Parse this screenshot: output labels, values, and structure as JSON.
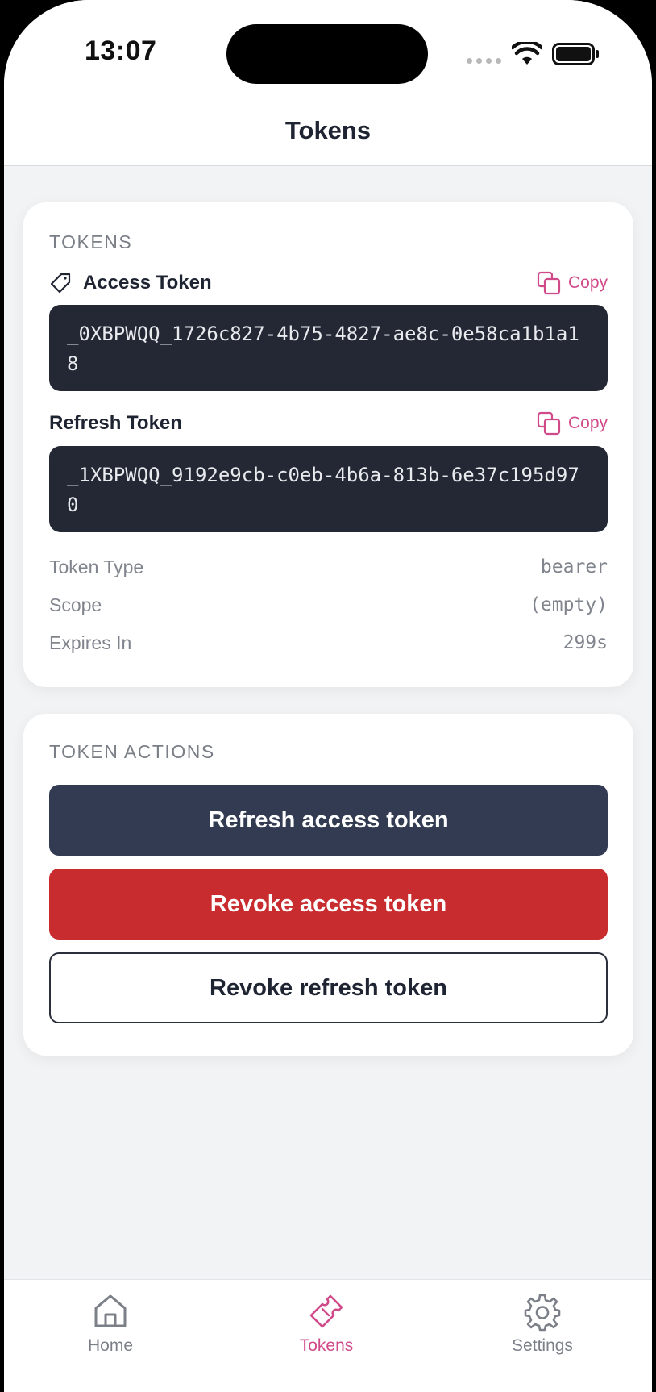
{
  "status_bar": {
    "time": "13:07"
  },
  "header": {
    "title": "Tokens"
  },
  "tokens_card": {
    "section_title": "TOKENS",
    "access_token": {
      "label": "Access Token",
      "copy_label": "Copy",
      "value": "_0XBPWQQ_1726c827-4b75-4827-ae8c-0e58ca1b1a18"
    },
    "refresh_token": {
      "label": "Refresh Token",
      "copy_label": "Copy",
      "value": "_1XBPWQQ_9192e9cb-c0eb-4b6a-813b-6e37c195d970"
    },
    "meta": {
      "token_type_label": "Token Type",
      "token_type_value": "bearer",
      "scope_label": "Scope",
      "scope_value": "(empty)",
      "expires_in_label": "Expires In",
      "expires_in_value": "299s"
    }
  },
  "actions_card": {
    "section_title": "TOKEN ACTIONS",
    "refresh_access_label": "Refresh access token",
    "revoke_access_label": "Revoke access token",
    "revoke_refresh_label": "Revoke refresh token"
  },
  "tab_bar": {
    "items": [
      {
        "label": "Home",
        "icon": "home-icon",
        "active": false
      },
      {
        "label": "Tokens",
        "icon": "ticket-icon",
        "active": true
      },
      {
        "label": "Settings",
        "icon": "gear-icon",
        "active": false
      }
    ]
  },
  "colors": {
    "accent": "#d04a8a",
    "primary_button": "#323b52",
    "danger_button": "#c82c2e",
    "token_box_bg": "#232834",
    "background": "#f2f3f5"
  }
}
